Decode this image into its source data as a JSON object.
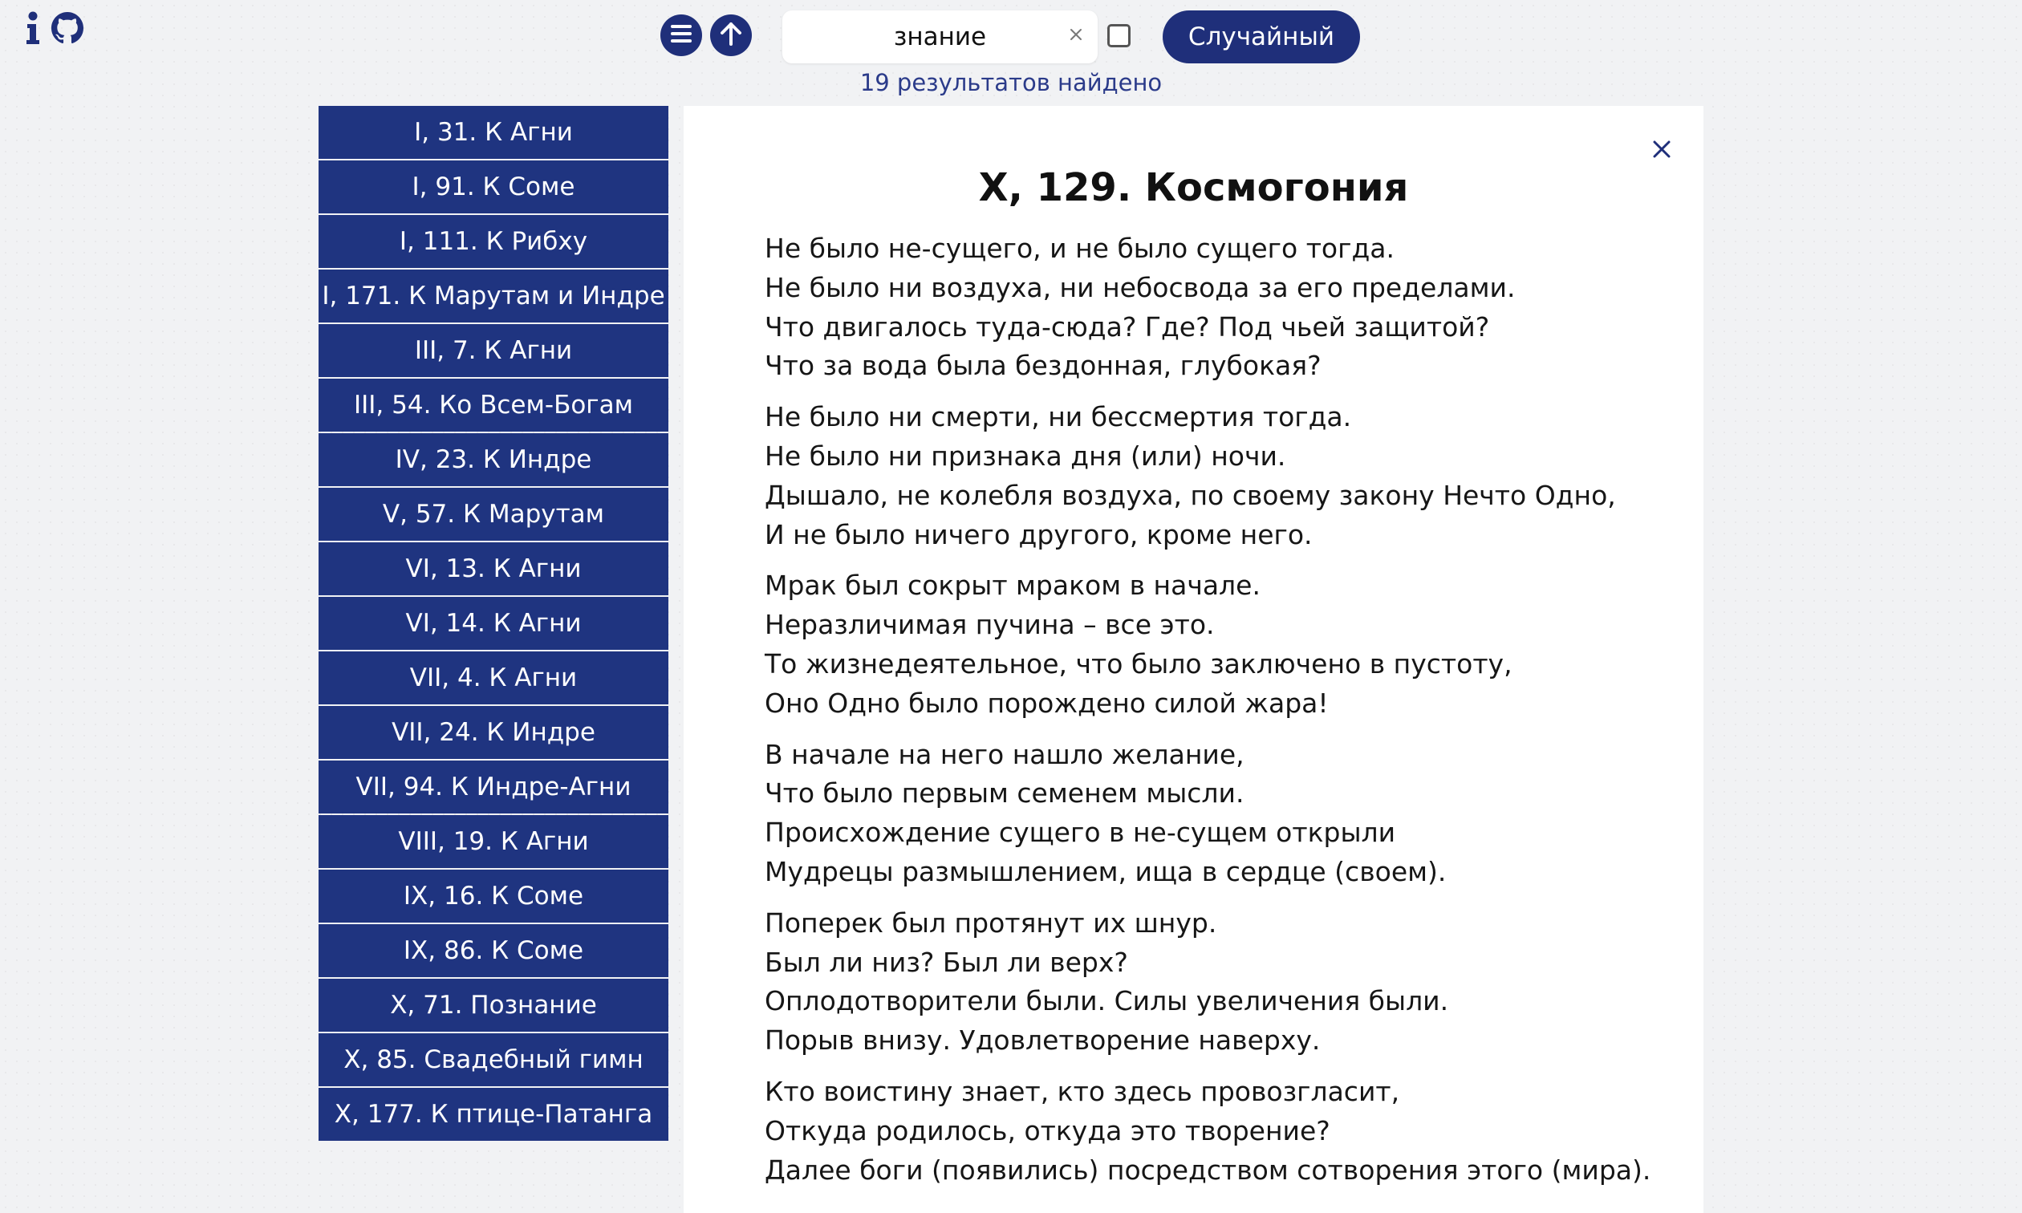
{
  "toolbar": {
    "search": {
      "value": "знание",
      "clear_glyph": "×"
    },
    "random_label": "Случайный",
    "results_count": "19 результатов найдено",
    "icons": {
      "info": "info-icon",
      "github": "github-icon",
      "menu": "menu-icon",
      "up": "arrow-up-icon",
      "clear": "close-icon",
      "checkbox": "checkbox-unchecked"
    },
    "colors": {
      "accent": "#1f2f7a",
      "list_item": "#1f3480",
      "results_text": "#2b3b8a"
    }
  },
  "results": [
    "I, 31. К Агни",
    "I, 91. К Соме",
    "I, 111. К Рибху",
    "I, 171. К Марутам и Индре",
    "III, 7. К Агни",
    "III, 54. Ко Всем-Богам",
    "IV, 23. К Индре",
    "V, 57. К Марутам",
    "VI, 13. К Агни",
    "VI, 14. К Агни",
    "VII, 4. К Агни",
    "VII, 24. К Индре",
    "VII, 94. К Индре-Агни",
    "VIII, 19. К Агни",
    "IX, 16. К Соме",
    "IX, 86. К Соме",
    "X, 71. Познание",
    "X, 85. Свадебный гимн",
    "X, 177. К птице-Патанга"
  ],
  "hymn": {
    "title": "X, 129. Космогония",
    "stanzas": [
      [
        "Не было не-сущего, и не было сущего тогда.",
        "Не было ни воздуха, ни небосвода за его пределами.",
        "Что двигалось туда-сюда? Где? Под чьей защитой?",
        "Что за вода была бездонная, глубокая?"
      ],
      [
        "Не было ни смерти, ни бессмертия тогда.",
        "Не было ни признака дня (или) ночи.",
        "Дышало, не колебля воздуха, по своему закону Нечто Одно,",
        "И не было ничего другого, кроме него."
      ],
      [
        "Мрак был сокрыт мраком в начале.",
        "Неразличимая пучина – все это.",
        "То жизнедеятельное, что было заключено в пустоту,",
        "Оно Одно было порождено силой жара!"
      ],
      [
        "В начале на него нашло желание,",
        "Что было первым семенем мысли.",
        "Происхождение сущего в не-сущем открыли",
        "Мудрецы размышлением, ища в сердце (своем)."
      ],
      [
        "Поперек был протянут их шнур.",
        "Был ли низ? Был ли верх?",
        "Оплодотворители были. Силы увеличения были.",
        "Порыв внизу. Удовлетворение наверху."
      ],
      [
        "Кто воистину знает, кто здесь провозгласит,",
        "Откуда родилось, откуда это творение?",
        "Далее боги (появились) посредством сотворения этого (мира)."
      ]
    ]
  }
}
